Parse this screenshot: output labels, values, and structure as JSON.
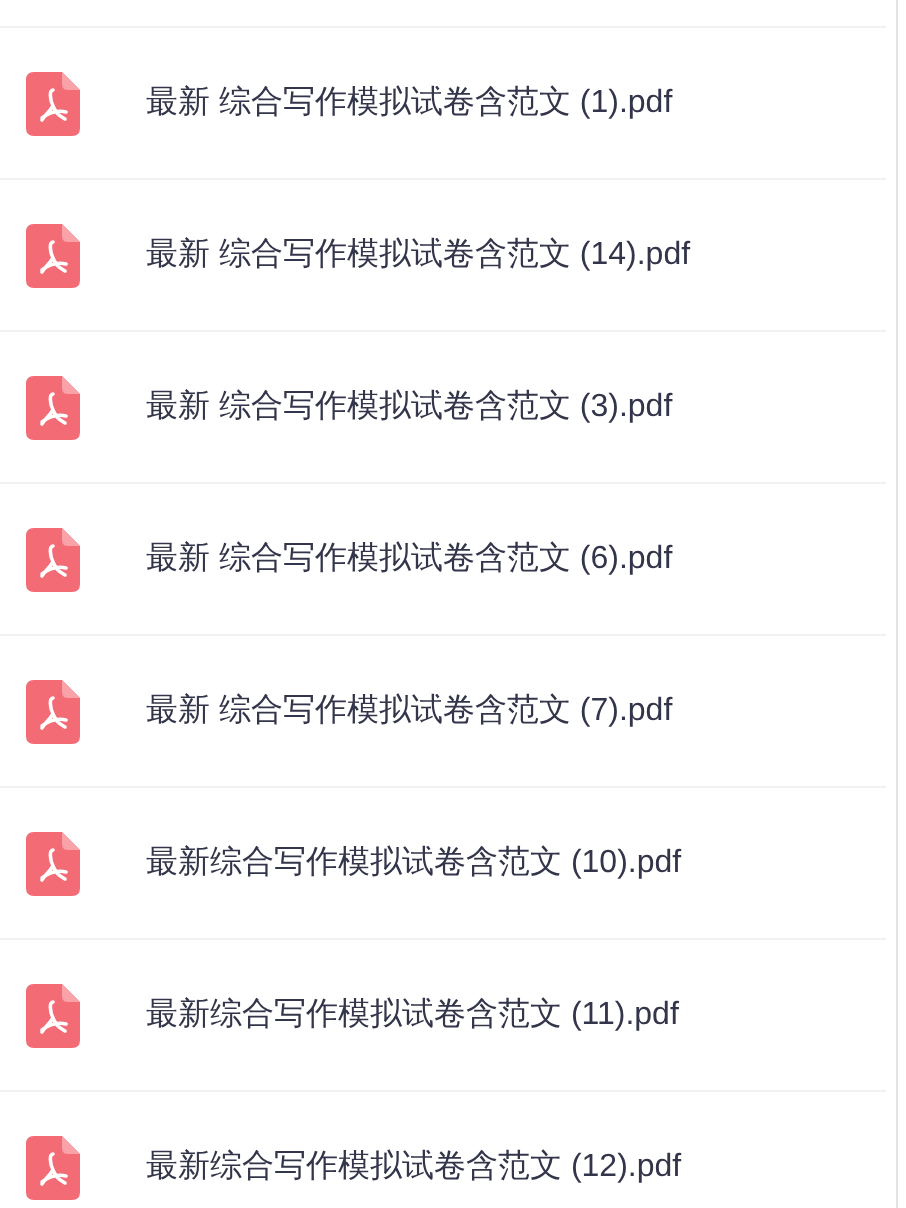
{
  "files": [
    {
      "name": "最新 综合写作模拟试卷含范文 (1).pdf",
      "kind": "pdf"
    },
    {
      "name": "最新 综合写作模拟试卷含范文 (14).pdf",
      "kind": "pdf"
    },
    {
      "name": "最新 综合写作模拟试卷含范文 (3).pdf",
      "kind": "pdf"
    },
    {
      "name": "最新 综合写作模拟试卷含范文 (6).pdf",
      "kind": "pdf"
    },
    {
      "name": "最新 综合写作模拟试卷含范文 (7).pdf",
      "kind": "pdf"
    },
    {
      "name": "最新综合写作模拟试卷含范文 (10).pdf",
      "kind": "pdf"
    },
    {
      "name": "最新综合写作模拟试卷含范文 (11).pdf",
      "kind": "pdf"
    },
    {
      "name": "最新综合写作模拟试卷含范文 (12).pdf",
      "kind": "pdf"
    }
  ]
}
